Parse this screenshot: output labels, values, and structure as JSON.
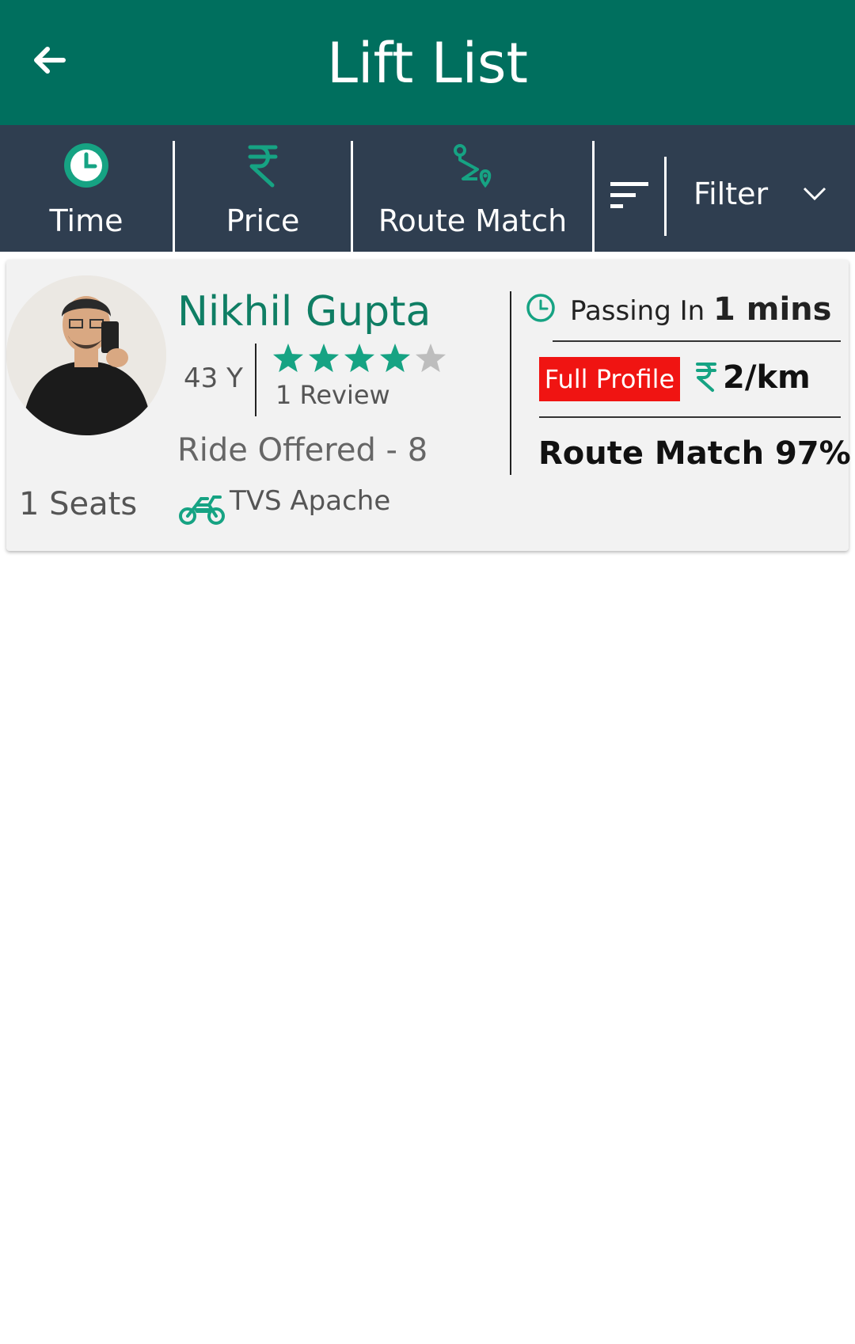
{
  "appbar": {
    "title": "Lift List",
    "back_icon": "arrow-left-icon"
  },
  "sortbar": {
    "items": [
      {
        "label": "Time",
        "icon": "clock-icon"
      },
      {
        "label": "Price",
        "icon": "rupee-icon"
      },
      {
        "label": "Route Match",
        "icon": "route-icon"
      }
    ],
    "sort_icon": "sort-icon",
    "filter_label": "Filter",
    "filter_icon": "chevron-down-icon"
  },
  "rides": [
    {
      "name": "Nikhil Gupta",
      "age": "43 Y",
      "rating": 4,
      "rating_max": 5,
      "reviews": "1 Review",
      "ride_offered": "Ride Offered - 8",
      "seats": "1 Seats",
      "vehicle": "TVS Apache",
      "passing_prefix": "Passing In",
      "passing_value": "1 mins",
      "full_profile_label": "Full Profile",
      "price": "2/km",
      "route_match": "Route Match 97%"
    }
  ],
  "colors": {
    "appbar": "#006f5e",
    "sortbar": "#2f3e50",
    "accent": "#16a383",
    "badge": "#f01412"
  }
}
